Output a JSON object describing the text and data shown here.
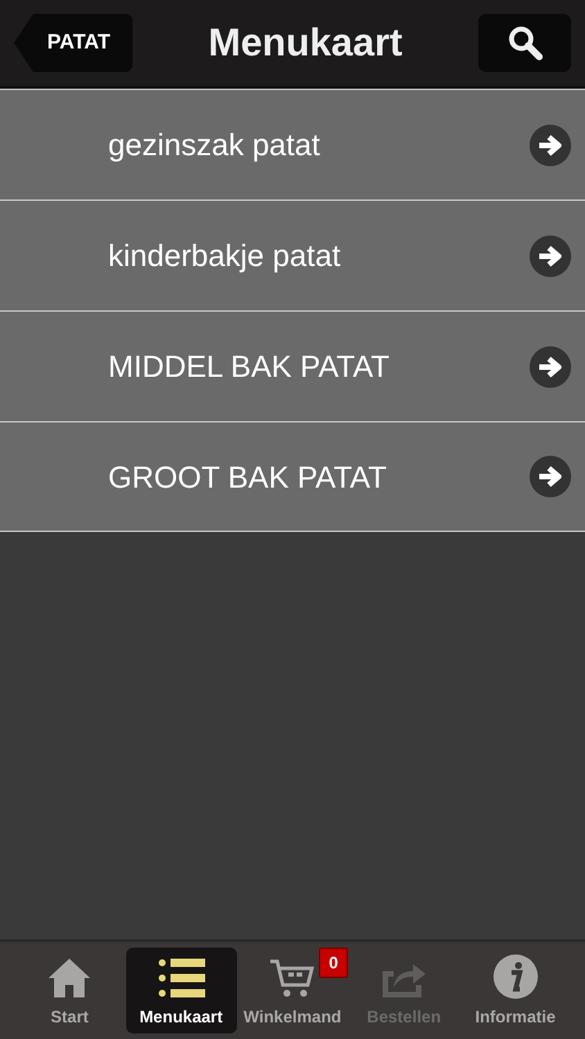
{
  "nav_bar": {
    "back_button": "PATAT",
    "title": "Menukaart"
  },
  "menu_items": [
    {
      "label": "gezinszak patat"
    },
    {
      "label": "kinderbakje patat"
    },
    {
      "label": "MIDDEL BAK PATAT"
    },
    {
      "label": "GROOT BAK PATAT"
    }
  ],
  "tab_bar": [
    {
      "kind": "home",
      "label": "Start",
      "selected": false,
      "disabled": false
    },
    {
      "kind": "list",
      "label": "Menukaart",
      "selected": true,
      "disabled": false
    },
    {
      "kind": "cart",
      "label": "Winkelmand",
      "selected": false,
      "disabled": false,
      "badge": "0"
    },
    {
      "kind": "share",
      "label": "Bestellen",
      "selected": false,
      "disabled": true
    },
    {
      "kind": "info",
      "label": "Informatie",
      "selected": false,
      "disabled": false
    }
  ]
}
